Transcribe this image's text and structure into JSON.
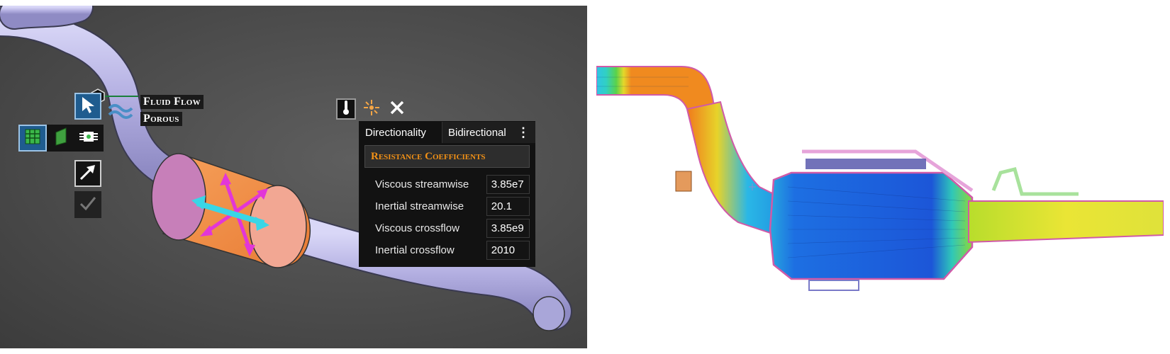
{
  "context_menu": {
    "fluid_flow_label": "Fluid Flow",
    "porous_label": "Porous"
  },
  "toolbar": {
    "icons": [
      "cursor-select-icon",
      "porous-grid-icon",
      "green-plane-icon",
      "ports-icon",
      "direction-arrow-icon",
      "checkmark-icon"
    ],
    "accent": "#1f5c8f"
  },
  "panel_icons": [
    "thermometer-icon",
    "flow-direction-icon",
    "close-icon"
  ],
  "panel": {
    "directionality_label": "Directionality",
    "directionality_value": "Bidirectional",
    "section_title": "Resistance Coefficients",
    "rows": [
      {
        "label": "Viscous streamwise",
        "value": "3.85e7"
      },
      {
        "label": "Inertial streamwise",
        "value": "20.1"
      },
      {
        "label": "Viscous crossflow",
        "value": "3.85e9"
      },
      {
        "label": "Inertial crossflow",
        "value": "2010"
      }
    ],
    "section_color": "#f29116"
  },
  "colors": {
    "pipe": "#b9b6e6",
    "converter": "#f5944f",
    "arrows_magenta": "#e236d8",
    "arrows_cyan": "#39d6e6"
  }
}
